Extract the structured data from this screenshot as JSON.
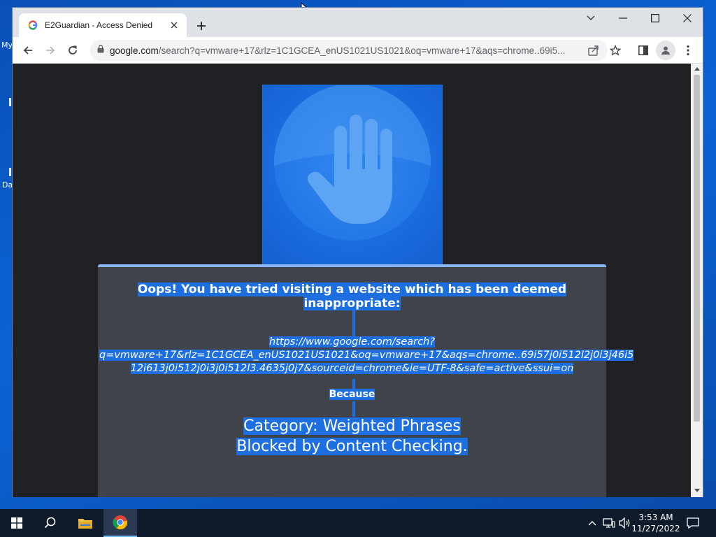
{
  "desktop": {
    "labels": [
      "My",
      "Da"
    ]
  },
  "browser": {
    "tab": {
      "title": "E2Guardian - Access Denied"
    },
    "address": {
      "host": "google.com",
      "path": "/search?q=vmware+17&rlz=1C1GCEA_enUS1021US1021&oq=vmware+17&aqs=chrome..69i5..."
    }
  },
  "page": {
    "headline": "Oops! You have tried visiting a website which has been deemed inappropriate:",
    "blocked_url_lines": [
      "https://www.google.com/search?",
      "q=vmware+17&rlz=1C1GCEA_enUS1021US1021&oq=vmware+17&aqs=chrome..69i57j0i512l2j0i3j46i5",
      "12i613j0i512j0i3j0i512l3.4635j0j7&sourceid=chrome&ie=UTF-8&safe=active&ssui=on"
    ],
    "because": "Because",
    "reason_line1": "Category: Weighted Phrases",
    "reason_line2": "Blocked by Content Checking."
  },
  "taskbar": {
    "time": "3:53 AM",
    "date": "11/27/2022"
  },
  "colors": {
    "accent_blue": "#1a73e8",
    "selection": "#1d6fe0",
    "panel_bg": "#404349",
    "page_bg": "#202124"
  }
}
